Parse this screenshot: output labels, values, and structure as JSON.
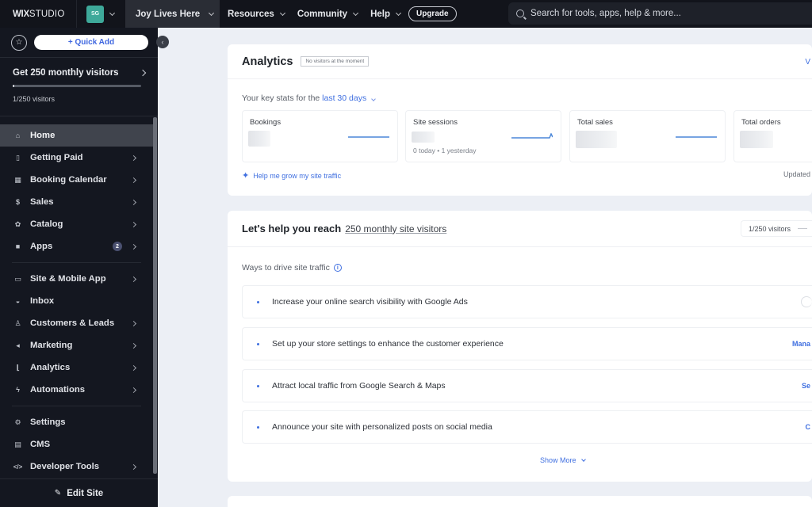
{
  "topbar": {
    "logo_bold": "WIX",
    "logo_light": "STUDIO",
    "account_initials": "SG",
    "site_name": "Joy Lives Here",
    "nav": [
      {
        "label": "Resources"
      },
      {
        "label": "Community"
      },
      {
        "label": "Help"
      }
    ],
    "upgrade_label": "Upgrade",
    "search_placeholder": "Search for tools, apps, help & more..."
  },
  "sidebar": {
    "quick_add_label": "+ Quick Add",
    "goal": {
      "title": "Get 250 monthly visitors",
      "progress_fraction": 0.004,
      "subtitle": "1/250 visitors"
    },
    "items": [
      {
        "label": "Home",
        "icon": "home-icon",
        "active": true
      },
      {
        "label": "Getting Paid",
        "icon": "getting-paid-icon",
        "chevron": true
      },
      {
        "label": "Booking Calendar",
        "icon": "calendar-icon",
        "chevron": true
      },
      {
        "label": "Sales",
        "icon": "dollar-icon",
        "chevron": true
      },
      {
        "label": "Catalog",
        "icon": "catalog-icon",
        "chevron": true
      },
      {
        "label": "Apps",
        "icon": "apps-icon",
        "badge": "2",
        "chevron": true
      },
      {
        "label": "Site & Mobile App",
        "icon": "site-mobile-icon",
        "chevron": true
      },
      {
        "label": "Inbox",
        "icon": "inbox-icon"
      },
      {
        "label": "Customers & Leads",
        "icon": "customers-icon",
        "chevron": true
      },
      {
        "label": "Marketing",
        "icon": "megaphone-icon",
        "chevron": true
      },
      {
        "label": "Analytics",
        "icon": "chart-icon",
        "chevron": true
      },
      {
        "label": "Automations",
        "icon": "automation-icon",
        "chevron": true
      },
      {
        "label": "Settings",
        "icon": "gear-icon"
      },
      {
        "label": "CMS",
        "icon": "cms-icon"
      },
      {
        "label": "Developer Tools",
        "icon": "code-icon",
        "chevron": true
      }
    ],
    "edit_site_label": "Edit Site"
  },
  "analytics": {
    "title": "Analytics",
    "tag": "No visitors at the moment",
    "view_link": "V",
    "key_stats_prefix": "Your key stats for the",
    "period": "last 30 days",
    "stats": [
      {
        "name": "Bookings",
        "sub": ""
      },
      {
        "name": "Site sessions",
        "sub": "0 today  •  1 yesterday"
      },
      {
        "name": "Total sales",
        "sub": ""
      },
      {
        "name": "Total orders",
        "sub": ""
      }
    ],
    "help_link": "Help me grow my site traffic",
    "updated": "Updated"
  },
  "reach": {
    "title": "Let's help you reach",
    "goal_link": "250 monthly site visitors",
    "visitors_pill": "1/250 visitors",
    "ways_label": "Ways to drive site traffic",
    "tips": [
      {
        "text": "Increase your online search visibility with Google Ads",
        "action": ""
      },
      {
        "text": "Set up your store settings to enhance the customer experience",
        "action": "Mana"
      },
      {
        "text": "Attract local traffic from Google Search & Maps",
        "action": "Se"
      },
      {
        "text": "Announce your site with personalized posts on social media",
        "action": "C"
      }
    ],
    "show_more": "Show More"
  },
  "colors": {
    "accent": "#3f6fe0",
    "topbar_bg": "#12141b",
    "sidebar_bg": "#141720",
    "avatar_bg": "#3ea99a",
    "page_bg": "#eceff5"
  }
}
